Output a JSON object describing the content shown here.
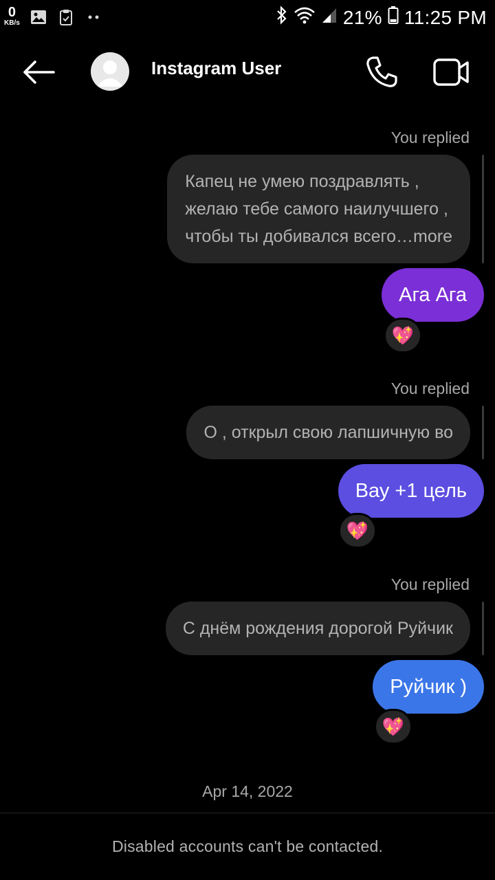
{
  "status_bar": {
    "speed_value": "0",
    "speed_unit": "KB/s",
    "battery_percent": "21%",
    "time": "11:25 PM"
  },
  "header": {
    "title": "Instagram User"
  },
  "messages": [
    {
      "label": "You replied",
      "quote_lines": [
        "Капец не умею поздравлять ,",
        "желаю тебе самого наилучшего ,",
        "чтобы ты добивался всего"
      ],
      "quote_more": "…more",
      "text": "Ага Ага",
      "reaction": "💖",
      "color": "#7b2fd6"
    },
    {
      "label": "You replied",
      "quote": "О , открыл свою лапшичную во",
      "text": "Вау +1 цель",
      "reaction": "💖",
      "color": "#5b4ee0"
    },
    {
      "label": "You replied",
      "quote": "С днём рождения дорогой Руйчик",
      "text": "Руйчик )",
      "reaction": "💖",
      "color": "#3b76e8"
    }
  ],
  "date": "Apr 14, 2022",
  "footer": "Disabled accounts can't be contacted."
}
